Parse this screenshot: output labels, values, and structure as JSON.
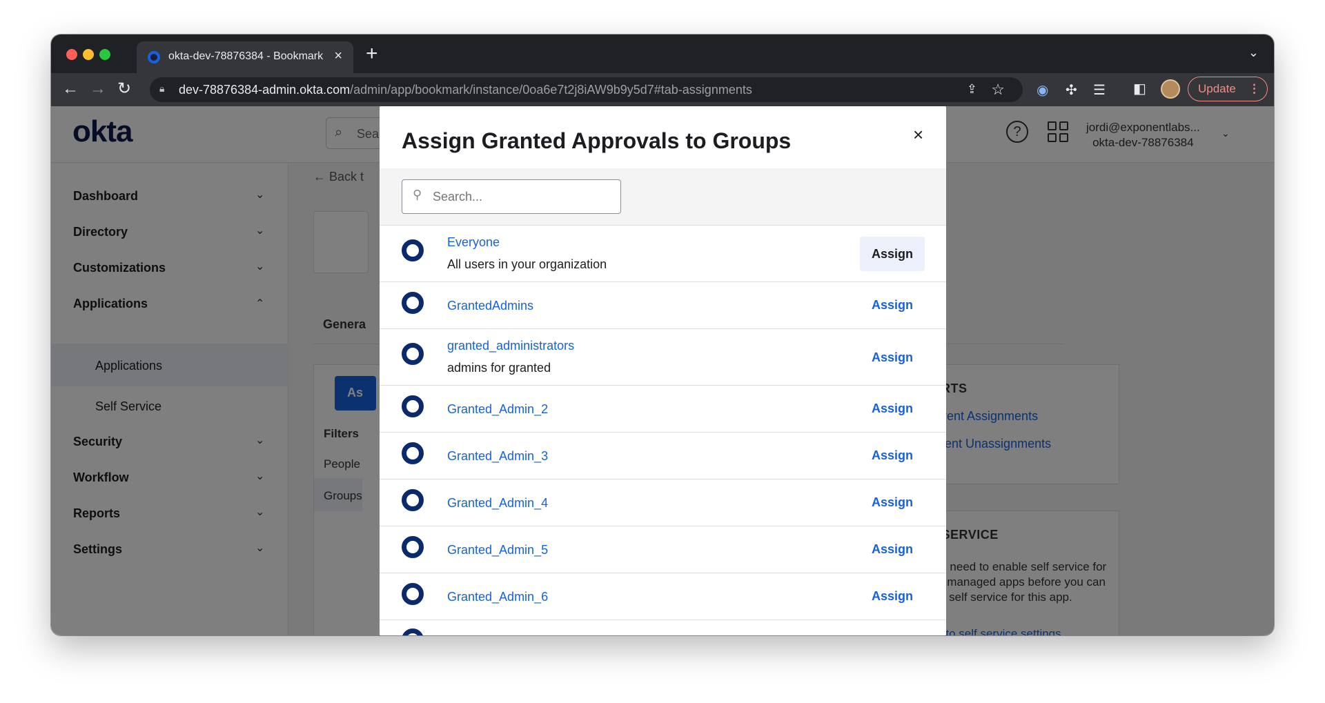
{
  "browser": {
    "tab_title": "okta-dev-78876384 - Bookmark",
    "tab_close": "×",
    "new_tab": "+",
    "url_host": "dev-78876384-admin.okta.com",
    "url_path": "/admin/app/bookmark/instance/0oa6e7t2j8iAW9b9y5d7#tab-assignments",
    "update_label": "Update"
  },
  "header": {
    "logo": "okta",
    "search_placeholder": "Sea",
    "help": "?",
    "user_email": "jordi@exponentlabs...",
    "user_org": "okta-dev-78876384"
  },
  "sidebar": {
    "items": [
      {
        "label": "Dashboard"
      },
      {
        "label": "Directory"
      },
      {
        "label": "Customizations"
      },
      {
        "label": "Applications"
      },
      {
        "label": "Security"
      },
      {
        "label": "Workflow"
      },
      {
        "label": "Reports"
      },
      {
        "label": "Settings"
      }
    ],
    "sub_items": [
      {
        "label": "Applications"
      },
      {
        "label": "Self Service"
      }
    ]
  },
  "content": {
    "back_label": "← Back t",
    "general_tab": "Genera",
    "assign_btn": "As",
    "filters_title": "Filters",
    "filter_people": "People",
    "filter_groups": "Groups",
    "reports_title": "REPORTS",
    "reports_links": [
      "Current Assignments",
      "Recent Unassignments"
    ],
    "self_service_title": "SELF SERVICE",
    "self_service_text": "You need to enable self service for org managed apps before you can use self service for this app.",
    "self_service_link": "Go to self service settings"
  },
  "modal": {
    "title": "Assign Granted Approvals to Groups",
    "close": "×",
    "search_placeholder": "Search...",
    "assign_label": "Assign",
    "groups": [
      {
        "name": "Everyone",
        "desc": "All users in your organization"
      },
      {
        "name": "GrantedAdmins",
        "desc": ""
      },
      {
        "name": "granted_administrators",
        "desc": "admins for granted"
      },
      {
        "name": "Granted_Admin_2",
        "desc": ""
      },
      {
        "name": "Granted_Admin_3",
        "desc": ""
      },
      {
        "name": "Granted_Admin_4",
        "desc": ""
      },
      {
        "name": "Granted_Admin_5",
        "desc": ""
      },
      {
        "name": "Granted_Admin_6",
        "desc": ""
      }
    ]
  },
  "colors": {
    "link": "#1662dd",
    "ring": "#0b2a6b",
    "overlay": "rgba(0,0,0,0.5)"
  }
}
